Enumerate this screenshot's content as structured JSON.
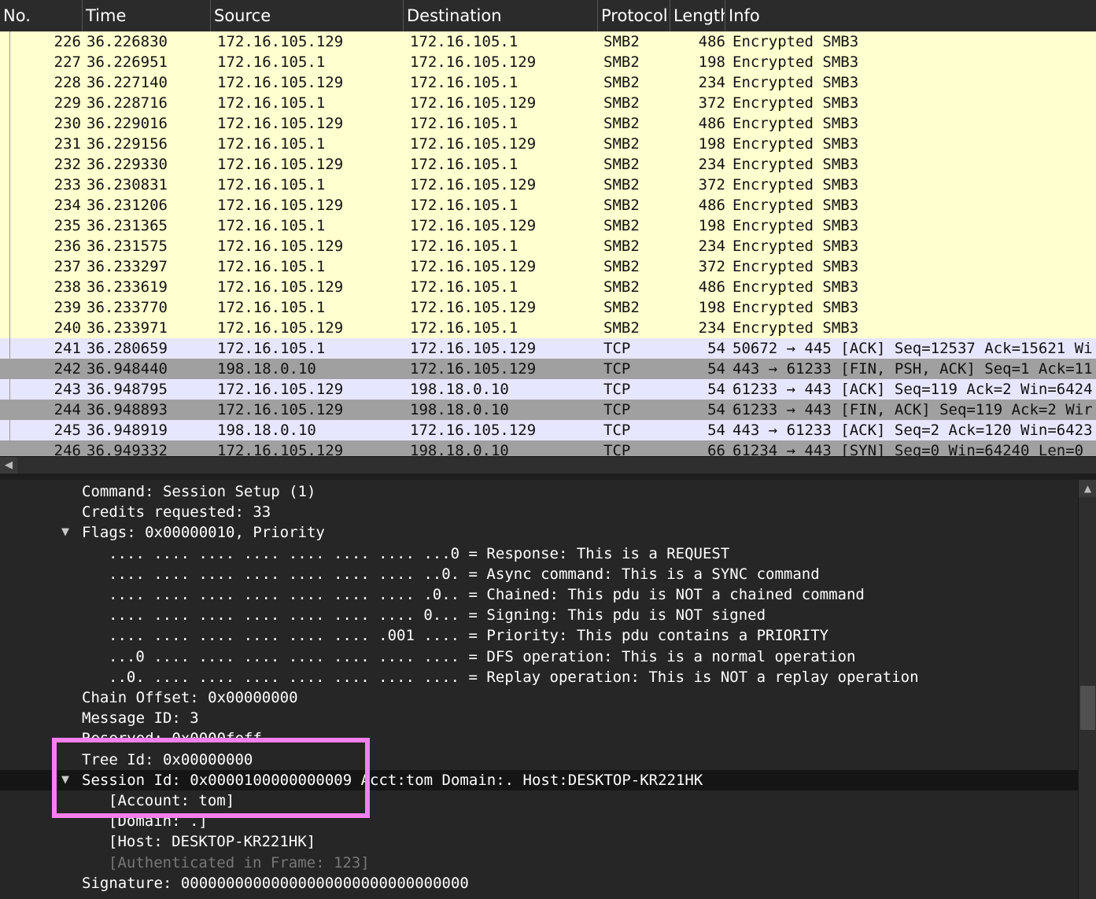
{
  "columns": {
    "no": "No.",
    "time": "Time",
    "source": "Source",
    "destination": "Destination",
    "protocol": "Protocol",
    "length": "Length",
    "info": "Info"
  },
  "packets": [
    {
      "no": "226",
      "time": "36.226830",
      "source": "172.16.105.129",
      "destination": "172.16.105.1",
      "protocol": "SMB2",
      "length": "486",
      "info": "Encrypted SMB3",
      "kind": "smb"
    },
    {
      "no": "227",
      "time": "36.226951",
      "source": "172.16.105.1",
      "destination": "172.16.105.129",
      "protocol": "SMB2",
      "length": "198",
      "info": "Encrypted SMB3",
      "kind": "smb"
    },
    {
      "no": "228",
      "time": "36.227140",
      "source": "172.16.105.129",
      "destination": "172.16.105.1",
      "protocol": "SMB2",
      "length": "234",
      "info": "Encrypted SMB3",
      "kind": "smb"
    },
    {
      "no": "229",
      "time": "36.228716",
      "source": "172.16.105.1",
      "destination": "172.16.105.129",
      "protocol": "SMB2",
      "length": "372",
      "info": "Encrypted SMB3",
      "kind": "smb"
    },
    {
      "no": "230",
      "time": "36.229016",
      "source": "172.16.105.129",
      "destination": "172.16.105.1",
      "protocol": "SMB2",
      "length": "486",
      "info": "Encrypted SMB3",
      "kind": "smb"
    },
    {
      "no": "231",
      "time": "36.229156",
      "source": "172.16.105.1",
      "destination": "172.16.105.129",
      "protocol": "SMB2",
      "length": "198",
      "info": "Encrypted SMB3",
      "kind": "smb"
    },
    {
      "no": "232",
      "time": "36.229330",
      "source": "172.16.105.129",
      "destination": "172.16.105.1",
      "protocol": "SMB2",
      "length": "234",
      "info": "Encrypted SMB3",
      "kind": "smb"
    },
    {
      "no": "233",
      "time": "36.230831",
      "source": "172.16.105.1",
      "destination": "172.16.105.129",
      "protocol": "SMB2",
      "length": "372",
      "info": "Encrypted SMB3",
      "kind": "smb"
    },
    {
      "no": "234",
      "time": "36.231206",
      "source": "172.16.105.129",
      "destination": "172.16.105.1",
      "protocol": "SMB2",
      "length": "486",
      "info": "Encrypted SMB3",
      "kind": "smb"
    },
    {
      "no": "235",
      "time": "36.231365",
      "source": "172.16.105.1",
      "destination": "172.16.105.129",
      "protocol": "SMB2",
      "length": "198",
      "info": "Encrypted SMB3",
      "kind": "smb"
    },
    {
      "no": "236",
      "time": "36.231575",
      "source": "172.16.105.129",
      "destination": "172.16.105.1",
      "protocol": "SMB2",
      "length": "234",
      "info": "Encrypted SMB3",
      "kind": "smb"
    },
    {
      "no": "237",
      "time": "36.233297",
      "source": "172.16.105.1",
      "destination": "172.16.105.129",
      "protocol": "SMB2",
      "length": "372",
      "info": "Encrypted SMB3",
      "kind": "smb"
    },
    {
      "no": "238",
      "time": "36.233619",
      "source": "172.16.105.129",
      "destination": "172.16.105.1",
      "protocol": "SMB2",
      "length": "486",
      "info": "Encrypted SMB3",
      "kind": "smb"
    },
    {
      "no": "239",
      "time": "36.233770",
      "source": "172.16.105.1",
      "destination": "172.16.105.129",
      "protocol": "SMB2",
      "length": "198",
      "info": "Encrypted SMB3",
      "kind": "smb"
    },
    {
      "no": "240",
      "time": "36.233971",
      "source": "172.16.105.129",
      "destination": "172.16.105.1",
      "protocol": "SMB2",
      "length": "234",
      "info": "Encrypted SMB3",
      "kind": "smb"
    },
    {
      "no": "241",
      "time": "36.280659",
      "source": "172.16.105.1",
      "destination": "172.16.105.129",
      "protocol": "TCP",
      "length": "54",
      "info": "50672 → 445 [ACK] Seq=12537 Ack=15621 Wi",
      "kind": "tcp"
    },
    {
      "no": "242",
      "time": "36.948440",
      "source": "198.18.0.10",
      "destination": "172.16.105.129",
      "protocol": "TCP",
      "length": "54",
      "info": "443 → 61233 [FIN, PSH, ACK] Seq=1 Ack=11",
      "kind": "fin"
    },
    {
      "no": "243",
      "time": "36.948795",
      "source": "172.16.105.129",
      "destination": "198.18.0.10",
      "protocol": "TCP",
      "length": "54",
      "info": "61233 → 443 [ACK] Seq=119 Ack=2 Win=6424",
      "kind": "tcp"
    },
    {
      "no": "244",
      "time": "36.948893",
      "source": "172.16.105.129",
      "destination": "198.18.0.10",
      "protocol": "TCP",
      "length": "54",
      "info": "61233 → 443 [FIN, ACK] Seq=119 Ack=2 Wir",
      "kind": "fin"
    },
    {
      "no": "245",
      "time": "36.948919",
      "source": "198.18.0.10",
      "destination": "172.16.105.129",
      "protocol": "TCP",
      "length": "54",
      "info": "443 → 61233 [ACK] Seq=2 Ack=120 Win=6423",
      "kind": "tcp"
    },
    {
      "no": "246",
      "time": "36.949332",
      "source": "172.16.105.129",
      "destination": "198.18.0.10",
      "protocol": "TCP",
      "length": "66",
      "info": "61234 → 443 [SYN] Seq=0 Win=64240 Len=0",
      "kind": "fin"
    }
  ],
  "details": [
    {
      "text": "Command: Session Setup (1)",
      "indent": 1,
      "arrow": false
    },
    {
      "text": "Credits requested: 33",
      "indent": 1,
      "arrow": false
    },
    {
      "text": "Flags: 0x00000010, Priority",
      "indent": 1,
      "arrow": true
    },
    {
      "text": ".... .... .... .... .... .... .... ...0 = Response: This is a REQUEST",
      "indent": 2,
      "arrow": false
    },
    {
      "text": ".... .... .... .... .... .... .... ..0. = Async command: This is a SYNC command",
      "indent": 2,
      "arrow": false
    },
    {
      "text": ".... .... .... .... .... .... .... .0.. = Chained: This pdu is NOT a chained command",
      "indent": 2,
      "arrow": false
    },
    {
      "text": ".... .... .... .... .... .... .... 0... = Signing: This pdu is NOT signed",
      "indent": 2,
      "arrow": false
    },
    {
      "text": ".... .... .... .... .... .... .001 .... = Priority: This pdu contains a PRIORITY",
      "indent": 2,
      "arrow": false
    },
    {
      "text": "...0 .... .... .... .... .... .... .... = DFS operation: This is a normal operation",
      "indent": 2,
      "arrow": false
    },
    {
      "text": "..0. .... .... .... .... .... .... .... = Replay operation: This is NOT a replay operation",
      "indent": 2,
      "arrow": false
    },
    {
      "text": "Chain Offset: 0x00000000",
      "indent": 1,
      "arrow": false
    },
    {
      "text": "Message ID: 3",
      "indent": 1,
      "arrow": false
    },
    {
      "text": "Reserved: 0x0000feff",
      "indent": 1,
      "arrow": false,
      "clipped": true
    },
    {
      "text": "Tree Id: 0x00000000",
      "indent": 1,
      "arrow": false
    },
    {
      "text": "Session Id: 0x0000100000000009 Acct:tom Domain:. Host:DESKTOP-KR221HK",
      "indent": 1,
      "arrow": true,
      "selected": true
    },
    {
      "text": "[Account: tom]",
      "indent": 2,
      "arrow": false
    },
    {
      "text": "[Domain: .]",
      "indent": 2,
      "arrow": false
    },
    {
      "text": "[Host: DESKTOP-KR221HK]",
      "indent": 2,
      "arrow": false
    },
    {
      "text": "[Authenticated in Frame: 123]",
      "indent": 2,
      "arrow": false,
      "dim": true
    },
    {
      "text": "Signature: 00000000000000000000000000000000",
      "indent": 1,
      "arrow": false
    }
  ],
  "colors": {
    "highlight_box": "#f77ff0",
    "smb_row": "#ffffcf",
    "tcp_row": "#e7e6ff",
    "fin_row": "#a0a0a0"
  }
}
